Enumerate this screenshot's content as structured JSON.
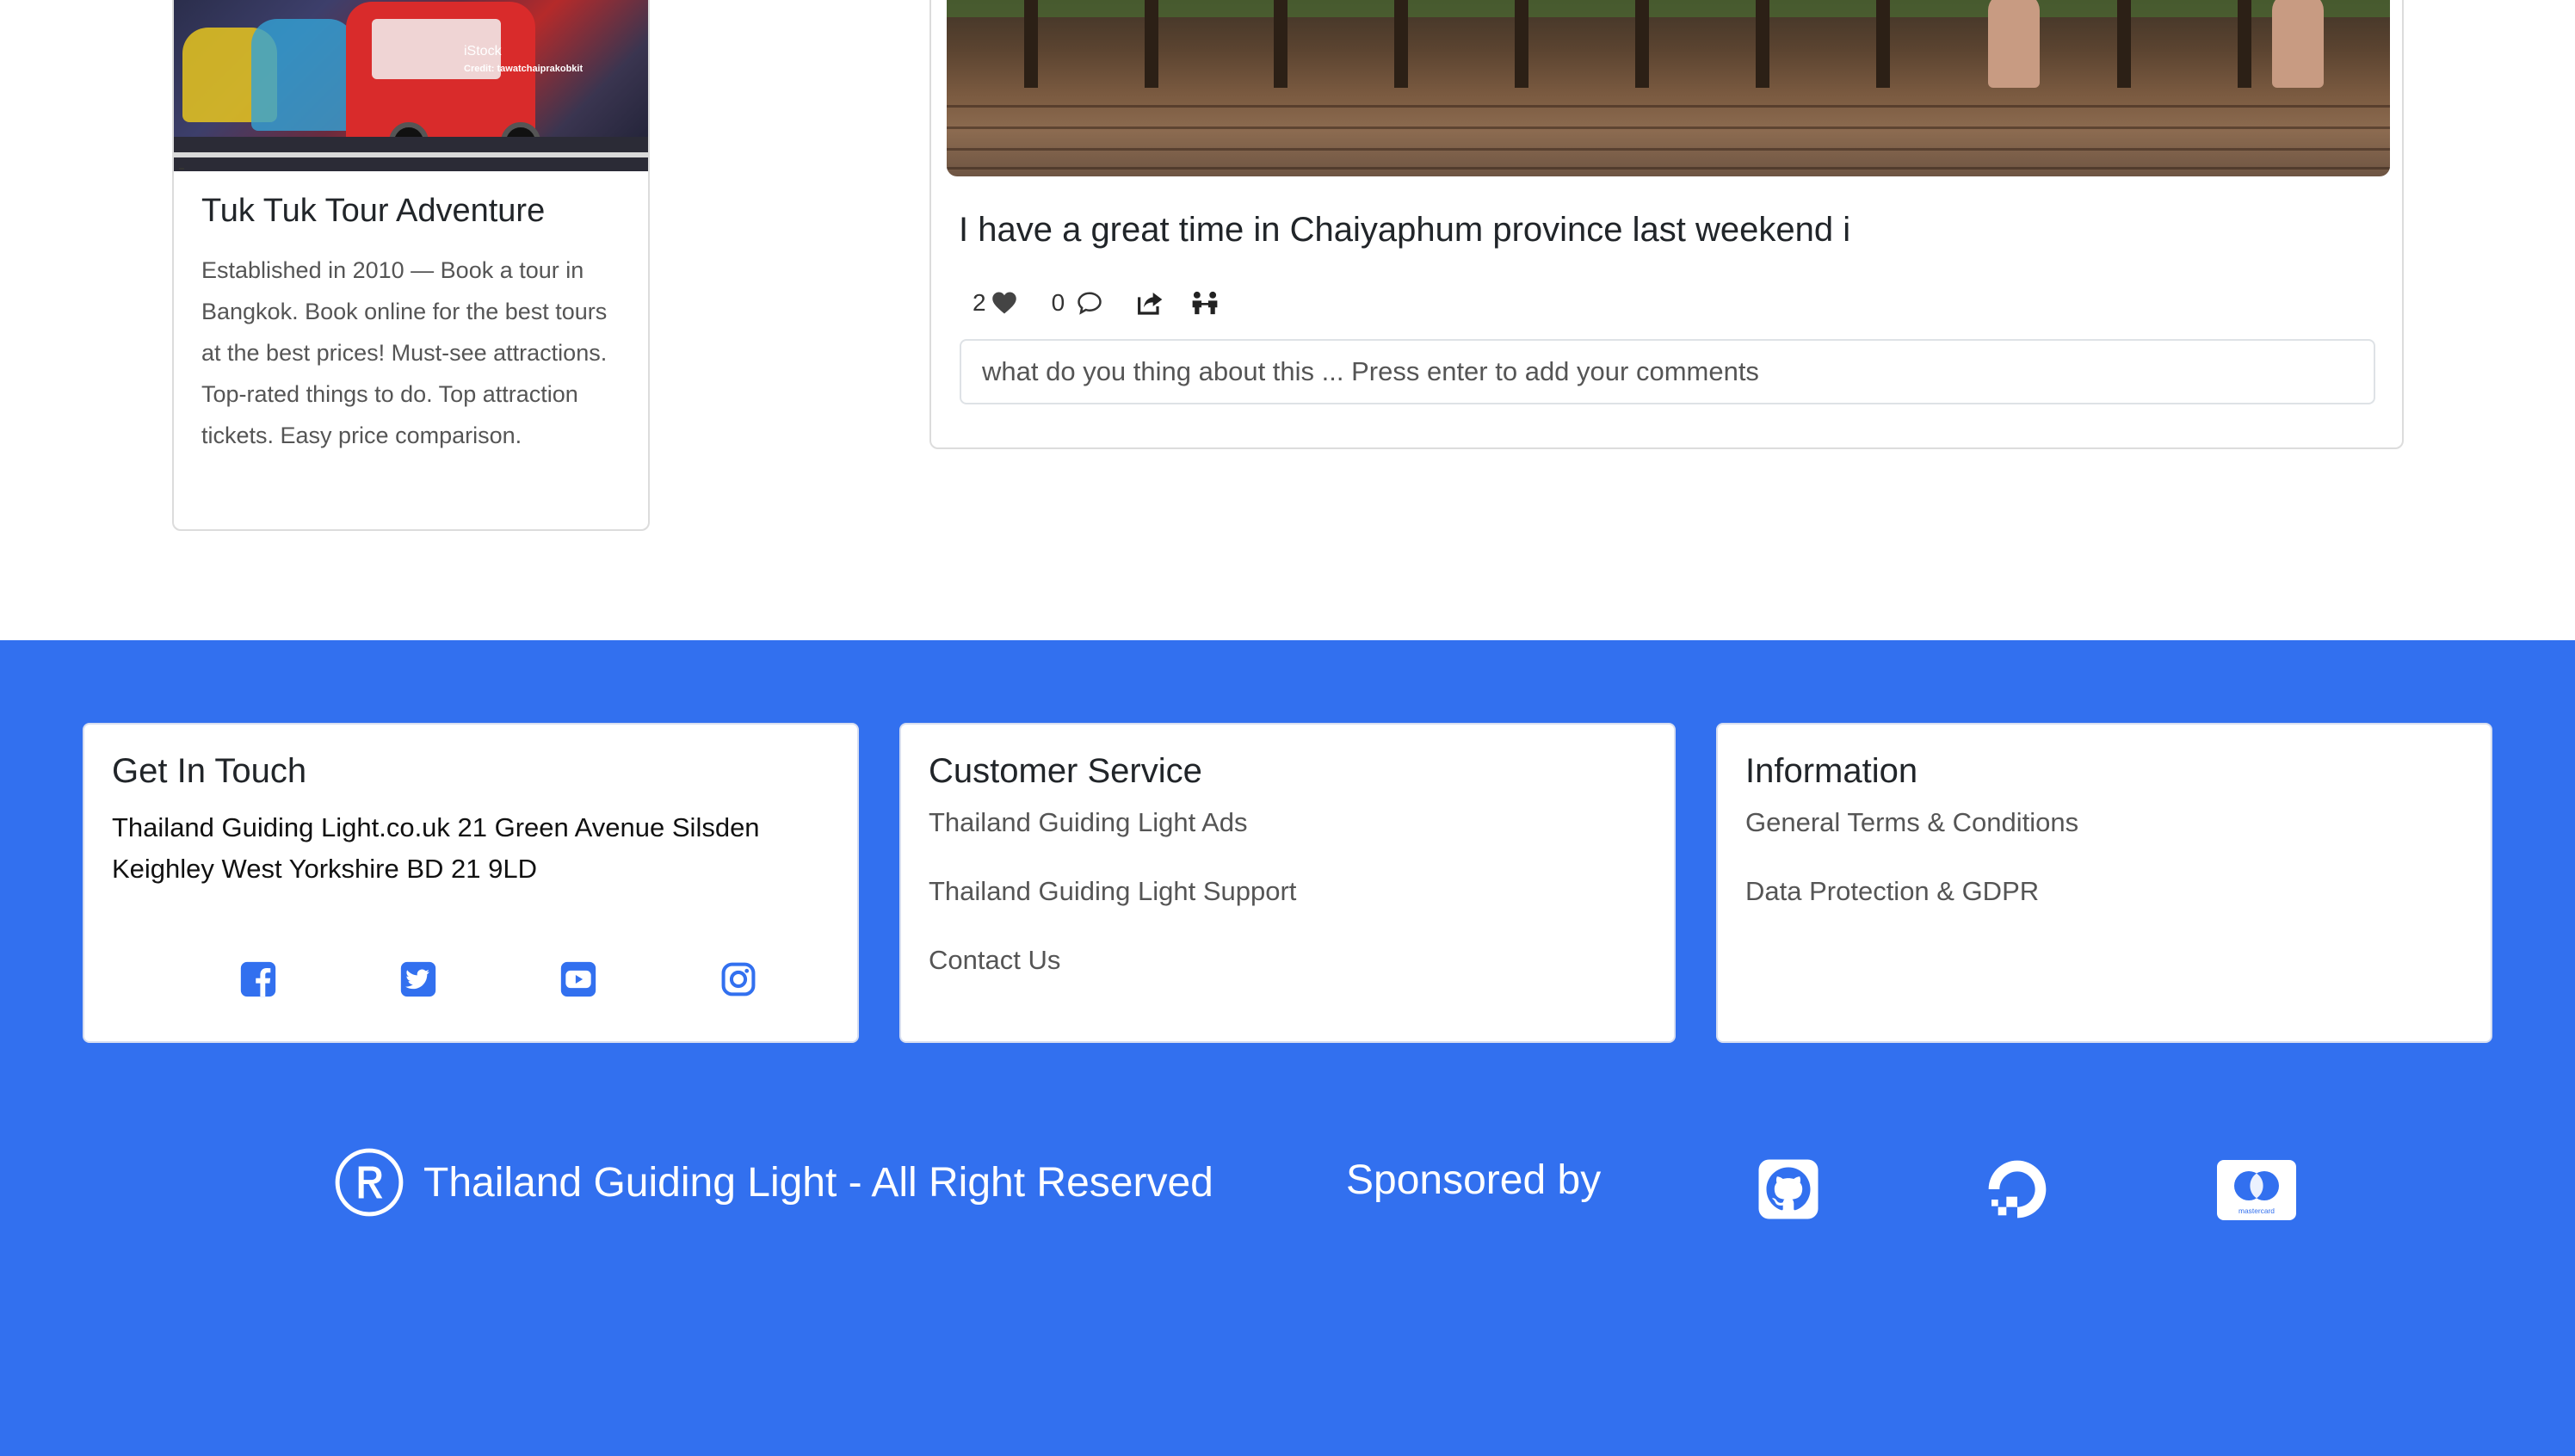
{
  "ad": {
    "image_credit_brand": "iStock",
    "image_credit_line": "Credit: tawatchaiprakobkit",
    "title": "Tuk Tuk Tour Adventure",
    "description": "Established in 2010 — Book a tour in Bangkok. Book online for the best tours at the best prices! Must-see attractions. Top-rated things to do. Top attraction tickets. Easy price comparison."
  },
  "post": {
    "title": "I have a great time in Chaiyaphum province last weekend i",
    "likes": "2",
    "comments": "0",
    "comment_placeholder": "what do you thing about this ... Press enter to add your comments"
  },
  "footer": {
    "get_in_touch": {
      "heading": "Get In Touch",
      "address": "Thailand Guiding Light.co.uk 21 Green Avenue Silsden Keighley West Yorkshire BD 21 9LD",
      "socials": [
        "facebook-icon",
        "twitter-icon",
        "youtube-icon",
        "instagram-icon"
      ]
    },
    "customer_service": {
      "heading": "Customer Service",
      "links": [
        "Thailand Guiding Light Ads",
        "Thailand Guiding Light Support",
        "Contact Us"
      ]
    },
    "information": {
      "heading": "Information",
      "links": [
        "General Terms & Conditions",
        "Data Protection & GDPR"
      ]
    },
    "copyright": "Thailand Guiding Light - All Right Reserved",
    "sponsored_by": "Sponsored by",
    "sponsors": [
      "github-icon",
      "digitalocean-icon",
      "mastercard-icon"
    ],
    "mastercard_label": "mastercard"
  },
  "colors": {
    "footer_bg": "#3270ef",
    "social_icon": "#3270ef"
  }
}
